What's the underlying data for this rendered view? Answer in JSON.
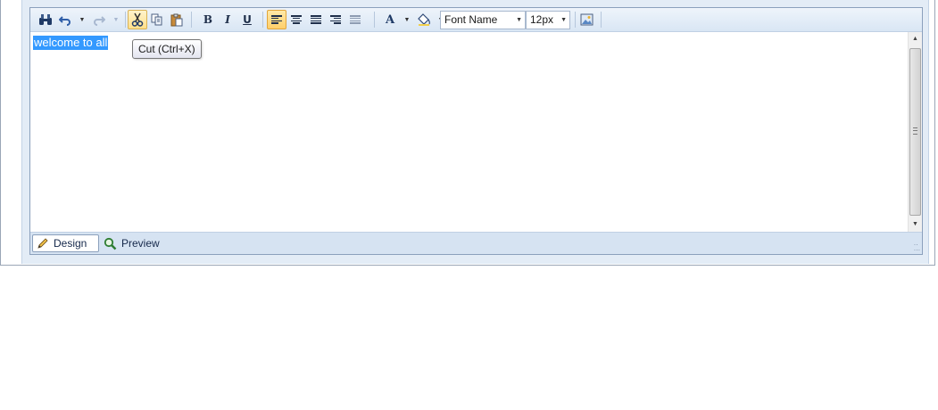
{
  "toolbar": {
    "buttons": [
      {
        "name": "find-replace",
        "icon": "binoculars-icon"
      },
      {
        "name": "undo",
        "icon": "undo-icon"
      },
      {
        "name": "redo",
        "icon": "redo-icon"
      },
      {
        "name": "cut",
        "icon": "scissors-icon",
        "state": "hover"
      },
      {
        "name": "copy",
        "icon": "copy-icon"
      },
      {
        "name": "paste",
        "icon": "paste-icon"
      },
      {
        "name": "bold",
        "icon": "bold-icon",
        "label": "B"
      },
      {
        "name": "italic",
        "icon": "italic-icon",
        "label": "I"
      },
      {
        "name": "underline",
        "icon": "underline-icon",
        "label": "U"
      },
      {
        "name": "align-left",
        "icon": "align-left-icon",
        "state": "active"
      },
      {
        "name": "align-center",
        "icon": "align-center-icon"
      },
      {
        "name": "justify",
        "icon": "align-justify-icon"
      },
      {
        "name": "align-right",
        "icon": "align-right-icon"
      },
      {
        "name": "justify-none",
        "icon": "align-none-icon"
      },
      {
        "name": "fore-color",
        "icon": "font-color-icon",
        "label": "A"
      },
      {
        "name": "back-color",
        "icon": "paint-bucket-icon"
      },
      {
        "name": "insert-image",
        "icon": "image-icon"
      }
    ],
    "font_name": "Font Name",
    "font_size": "12px"
  },
  "content": {
    "text": "welcome to all"
  },
  "tooltip": {
    "text": "Cut (Ctrl+X)"
  },
  "footer": {
    "design_label": "Design",
    "preview_label": "Preview"
  },
  "colors": {
    "selection": "#3399ff",
    "toolbar_bg": "#dce8f5",
    "active_button": "#ffcf6a",
    "border": "#8ba0bc"
  }
}
